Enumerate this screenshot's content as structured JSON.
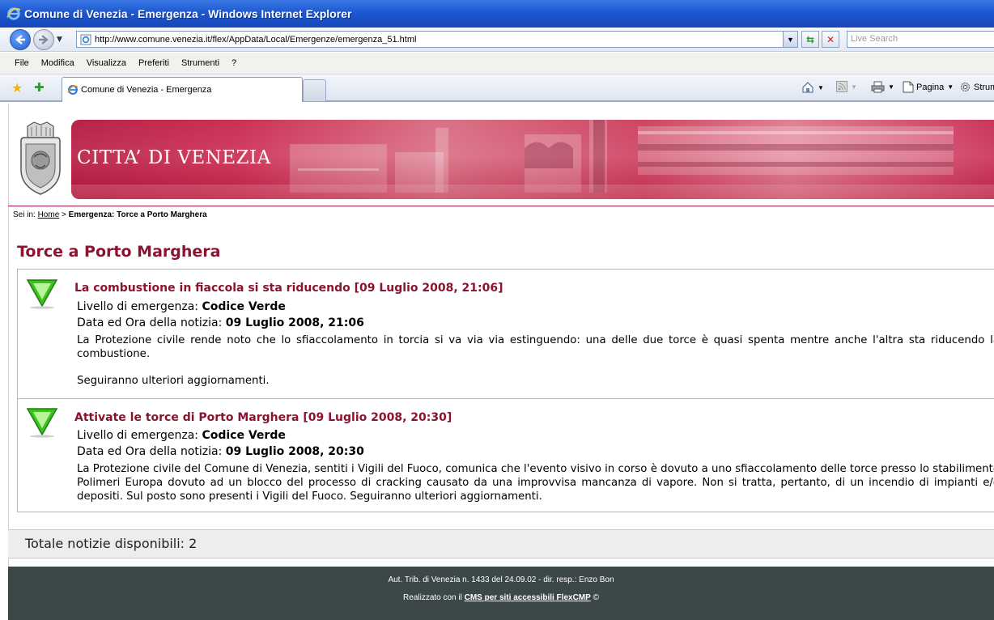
{
  "window": {
    "title": "Comune di Venezia - Emergenza - Windows Internet Explorer"
  },
  "addressbar": {
    "url": "http://www.comune.venezia.it/flex/AppData/Local/Emergenze/emergenza_51.html",
    "search_placeholder": "Live Search"
  },
  "menu": {
    "items": [
      "File",
      "Modifica",
      "Visualizza",
      "Preferiti",
      "Strumenti",
      "?"
    ]
  },
  "tabs": {
    "active_label": "Comune di Venezia - Emergenza"
  },
  "commandbar": {
    "page_label": "Pagina",
    "tools_label": "Strumenti"
  },
  "site": {
    "banner_title": "CITTA’ DI VENEZIA"
  },
  "breadcrumb": {
    "prefix": "Sei in:",
    "home": "Home",
    "separator": ">",
    "current": "Emergenza: Torce a Porto Marghera"
  },
  "page": {
    "title": "Torce a Porto Marghera"
  },
  "news": [
    {
      "heading": "La combustione in fiaccola si sta riducendo [09 Luglio 2008, 21:06]",
      "level_label": "Livello di emergenza:",
      "level_value": "Codice Verde",
      "date_label": "Data ed Ora della notizia:",
      "date_value": "09 Luglio 2008, 21:06",
      "body_1": "La Protezione civile rende noto che lo sfiaccolamento in torcia si va via via estinguendo: una delle due torce è quasi spenta mentre anche l'altra sta riducendo la combustione.",
      "body_2": "Seguiranno ulteriori aggiornamenti."
    },
    {
      "heading": "Attivate le torce di Porto Marghera [09 Luglio 2008, 20:30]",
      "level_label": "Livello di emergenza:",
      "level_value": "Codice Verde",
      "date_label": "Data ed Ora della notizia:",
      "date_value": "09 Luglio 2008, 20:30",
      "body_1": "La Protezione civile del Comune di Venezia, sentiti i Vigili del Fuoco, comunica che l'evento visivo in corso è dovuto a uno sfiaccolamento delle torce presso lo stabilimento Polimeri Europa dovuto ad un blocco del processo di cracking causato da una improvvisa mancanza di vapore. Non si tratta, pertanto, di un incendio di impianti e/o depositi. Sul posto sono presenti i Vigili del Fuoco. Seguiranno ulteriori aggiornamenti."
    }
  ],
  "summary": {
    "total_text": "Totale notizie disponibili: 2"
  },
  "footer": {
    "line1": "Aut. Trib. di Venezia n. 1433 del 24.09.02 - dir. resp.: Enzo Bon",
    "line2_prefix": "Realizzato con il",
    "line2_link": "CMS per siti accessibili FlexCMP",
    "line2_suffix": "©"
  },
  "icons": {
    "emergency_level": "green-triangle-icon",
    "browser": "ie-icon"
  },
  "colors": {
    "title_red": "#8b1330",
    "banner_red": "#c9254c",
    "footer_bg": "#3b4847",
    "code_green": "#3cc11e"
  }
}
